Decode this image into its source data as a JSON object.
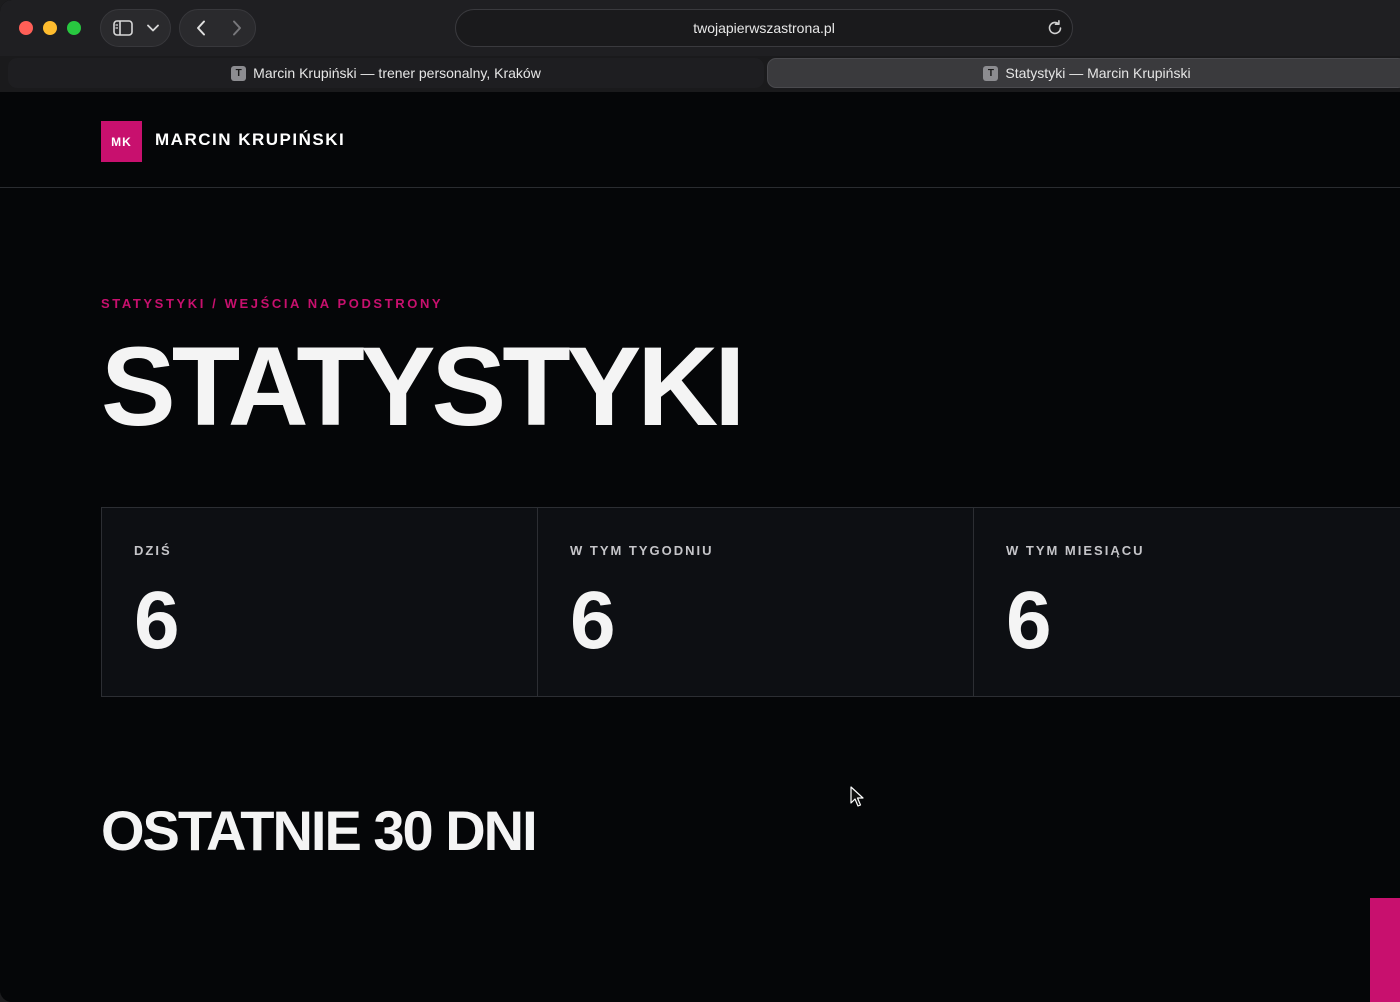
{
  "browser": {
    "url": "twojapierwszastrona.pl",
    "tabs": [
      {
        "label": "Marcin Krupiński — trener personalny, Kraków",
        "favicon": "T",
        "active": false
      },
      {
        "label": "Statystyki — Marcin Krupiński",
        "favicon": "T",
        "active": true
      }
    ]
  },
  "site": {
    "logo_initials": "MK",
    "name": "MARCIN KRUPIŃSKI",
    "accent_color": "#c8106e"
  },
  "main": {
    "eyebrow": "STATYSTYKI / WEJŚCIA NA PODSTRONY",
    "title": "STATYSTYKI",
    "stats": [
      {
        "label": "DZIŚ",
        "value": "6"
      },
      {
        "label": "W TYM TYGODNIU",
        "value": "6"
      },
      {
        "label": "W TYM MIESIĄCU",
        "value": "6"
      }
    ],
    "section_title": "OSTATNIE 30 DNI"
  }
}
